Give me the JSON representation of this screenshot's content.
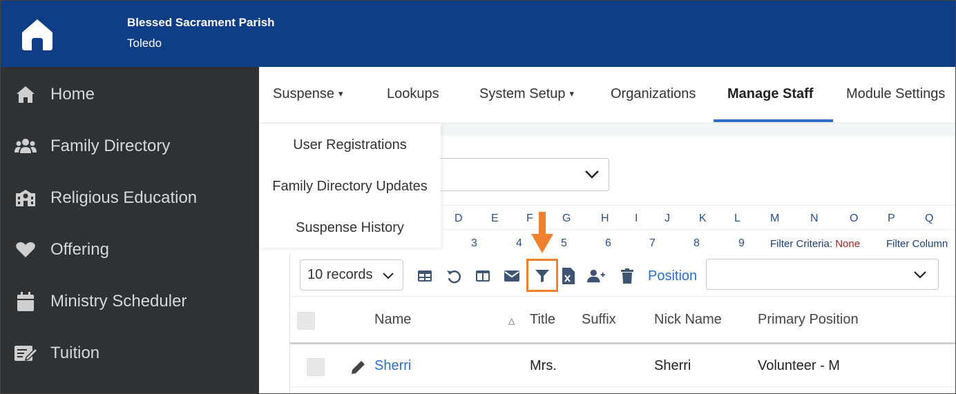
{
  "header": {
    "parish_name": "Blessed Sacrament Parish",
    "city": "Toledo",
    "logo_icon": "home-icon",
    "bg_color": "#0f3e86"
  },
  "sidebar": {
    "items": [
      {
        "label": "Home",
        "icon": "home-icon"
      },
      {
        "label": "Family Directory",
        "icon": "users-icon"
      },
      {
        "label": "Religious Education",
        "icon": "school-icon"
      },
      {
        "label": "Offering",
        "icon": "heart-icon"
      },
      {
        "label": "Ministry Scheduler",
        "icon": "calendar-icon"
      },
      {
        "label": "Tuition",
        "icon": "edit-icon"
      }
    ]
  },
  "tabs": {
    "items": [
      {
        "label": "Suspense",
        "has_caret": true
      },
      {
        "label": "Lookups"
      },
      {
        "label": "System Setup",
        "has_caret": true
      },
      {
        "label": "Organizations"
      },
      {
        "label": "Manage Staff",
        "active": true
      },
      {
        "label": "Module Settings"
      }
    ],
    "caret": "▾"
  },
  "dropdown": {
    "items": [
      "User Registrations",
      "Family Directory Updates",
      "Suspense History"
    ]
  },
  "letters": [
    "D",
    "E",
    "F",
    "G",
    "H",
    "I",
    "J",
    "K",
    "L",
    "M",
    "N",
    "O",
    "P",
    "Q"
  ],
  "numbers": [
    "3",
    "4",
    "5",
    "6",
    "7",
    "8",
    "9"
  ],
  "filter": {
    "criteria_label": "Filter Criteria:",
    "criteria_value": "None",
    "columns_label": "Filter Column"
  },
  "toolbar": {
    "records_label": "10 records",
    "position_label": "Position",
    "icons": [
      "table-icon",
      "undo-icon",
      "columns-icon",
      "mail-icon",
      "filter-icon",
      "excel-export-icon",
      "add-user-icon",
      "trash-icon"
    ],
    "highlight_color": "#f07f2e"
  },
  "grid": {
    "columns": [
      "Name",
      "Title",
      "Suffix",
      "Nick Name",
      "Primary Position"
    ],
    "sort_indicator": "△",
    "rows": [
      {
        "name": "Sherri",
        "title": "Mrs.",
        "suffix": "",
        "nick_name": "Sherri",
        "primary_position": "Volunteer - M"
      }
    ]
  }
}
